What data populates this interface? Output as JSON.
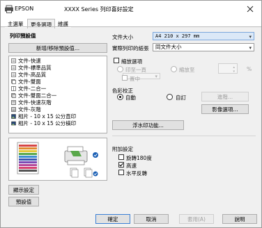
{
  "titlebar": {
    "brand": "EPSON",
    "title": "XXXX  Series 列印喜好設定",
    "close": "✕"
  },
  "tabs": [
    {
      "label": "主選單"
    },
    {
      "label": "更多選項"
    },
    {
      "label": "維護"
    }
  ],
  "left": {
    "presets_title": "列印預設值",
    "add_remove_button": "新增/移除預設值...",
    "presets": [
      {
        "label": "文件-快速"
      },
      {
        "label": "文件-標準品質"
      },
      {
        "label": "文件-高品質"
      },
      {
        "label": "文件-雙面"
      },
      {
        "label": "文件-二合一"
      },
      {
        "label": "文件-雙面二合一"
      },
      {
        "label": "文件-快速灰階"
      },
      {
        "label": "文件-灰階"
      },
      {
        "label": "相片 - 10 x 15 公分直印"
      },
      {
        "label": "相片 - 10 x 15 公分橫印"
      }
    ],
    "show_settings_button": "顯示設定",
    "defaults_button": "預設值"
  },
  "right": {
    "document_size_label": "文件大小",
    "document_size_value": "A4 210 x 297 mm",
    "output_paper_label": "實際列印的紙張",
    "output_paper_value": "同文件大小",
    "reduce_enlarge_label": "縮放選項",
    "fit_to_page_label": "印至一頁",
    "zoom_label": "縮放至",
    "percent_symbol": "%",
    "center_label": "置中",
    "color_correction_label": "色彩校正",
    "auto_label": "自動",
    "custom_label": "自訂",
    "advanced_button": "進階...",
    "image_options_button": "影像選項...",
    "watermark_button": "浮水印功能...",
    "additional_label": "附加設定",
    "rotate180_label": "旋轉180度",
    "high_speed_label": "高速",
    "mirror_label": "水平反轉"
  },
  "footer": {
    "ok": "確定",
    "cancel": "取消",
    "apply": "套用(A)",
    "help": "說明"
  },
  "colors": {
    "window_bg": "#f0f0f0",
    "accent_blue": "#0078d7",
    "check_blue": "#1a5fb4"
  }
}
